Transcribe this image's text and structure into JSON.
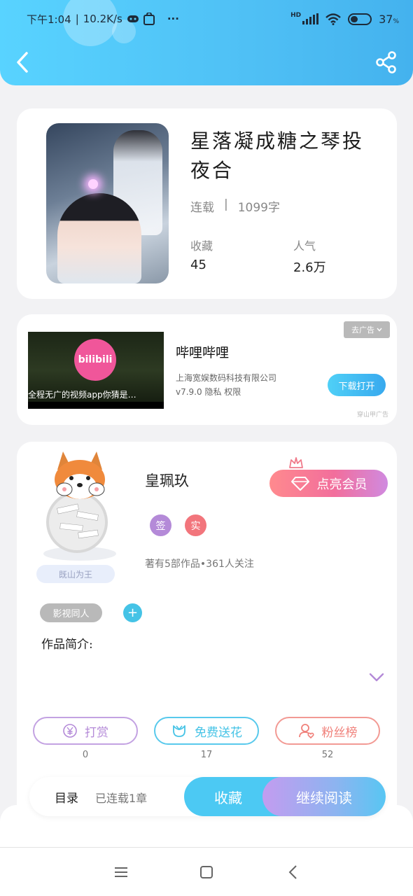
{
  "status_bar": {
    "time": "下午1:04",
    "speed": "10.2K/s",
    "dots": "···",
    "hd": "HD",
    "battery": "37",
    "battery_unit": "%"
  },
  "header": {
    "back_icon": "chevron-left-icon",
    "share_icon": "share-icon"
  },
  "book": {
    "title": "星落凝成糖之琴投夜合",
    "status": "连载",
    "separator": "|",
    "word_count": "1099字",
    "favorites_label": "收藏",
    "favorites_value": "45",
    "popularity_label": "人气",
    "popularity_value": "2.6万"
  },
  "ad": {
    "close_label": "去广告",
    "logo_text": "bilibili",
    "caption": "全程无广的视频app你猜是…",
    "app_name": "哔哩哔哩",
    "company": "上海宽娱数码科技有限公司",
    "version_line": "v7.9.0  隐私  权限",
    "download_label": "下载打开",
    "source": "穿山甲广告"
  },
  "author": {
    "avatar_tag": "既山为王",
    "name": "皇珮玖",
    "vip_label": "点亮会员",
    "badges": [
      "签",
      "实"
    ],
    "works_info": "著有5部作品•361人关注",
    "genre_tag": "影视同人",
    "add_label": "+",
    "intro_label": "作品简介:"
  },
  "actions": [
    {
      "label": "打赏",
      "count": "0",
      "icon": "yen-icon",
      "color": "#b48ad8"
    },
    {
      "label": "免费送花",
      "count": "17",
      "icon": "flower-icon",
      "color": "#45c3e6"
    },
    {
      "label": "粉丝榜",
      "count": "52",
      "icon": "fan-user-icon",
      "color": "#f0807a"
    }
  ],
  "bottom": {
    "toc_label": "目录",
    "toc_info": "已连载1章",
    "favorite_label": "收藏",
    "continue_label": "继续阅读"
  },
  "navbar": {
    "menu_icon": "menu-icon",
    "home_icon": "home-square-icon",
    "back_icon": "back-triangle-icon"
  }
}
